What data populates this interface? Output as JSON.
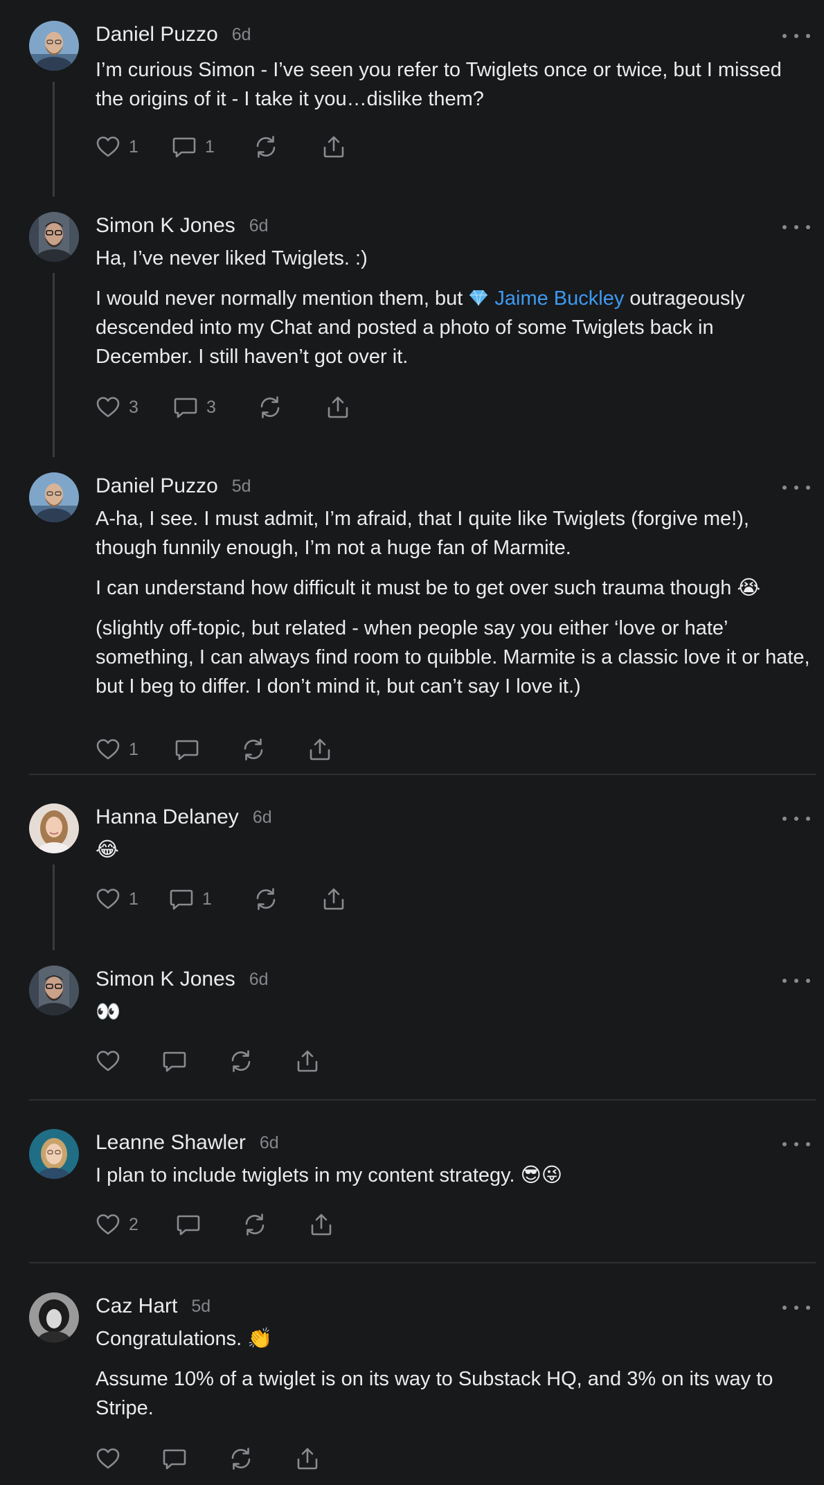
{
  "colors": {
    "background": "#18191b",
    "text": "#ececec",
    "muted": "#86878b",
    "mention": "#3d9af2",
    "thread_line": "#3a3b3e"
  },
  "icons": {
    "like": "heart-icon",
    "comment": "comment-icon",
    "restack": "restack-icon",
    "share": "share-icon",
    "more": "more-icon",
    "mention_badge": "diamond-icon"
  },
  "posts": [
    {
      "author": "Daniel Puzzo",
      "time": "6d",
      "paragraphs": [
        "I’m curious Simon - I’ve seen you refer to Twiglets once or twice, but I missed the origins of it - I take it you…dislike them?"
      ],
      "likes": "1",
      "comments": "1"
    },
    {
      "author": "Simon K Jones",
      "time": "6d",
      "paragraphs": [
        "Ha, I’ve never liked Twiglets. :)"
      ],
      "p2_before": "I would never normally mention them, but ",
      "mention": "Jaime Buckley",
      "p2_after": " outrageously descended into my Chat and posted a photo of some Twiglets back in December. I still haven’t got over it.",
      "likes": "3",
      "comments": "3"
    },
    {
      "author": "Daniel Puzzo",
      "time": "5d",
      "paragraphs": [
        "A-ha, I see. I must admit, I’m afraid, that I quite like Twiglets (forgive me!), though funnily enough, I’m not a huge fan of Marmite.",
        "I can understand how difficult it must be to get over such trauma though 😭",
        "(slightly off-topic, but related - when people say you either ‘love or hate’ something, I can always find room to quibble. Marmite is a classic love it or hate, but I beg to differ. I don’t mind it, but can’t say I love it.)"
      ],
      "likes": "1",
      "comments": ""
    },
    {
      "author": "Hanna Delaney",
      "time": "6d",
      "paragraphs": [
        "😂"
      ],
      "likes": "1",
      "comments": "1"
    },
    {
      "author": "Simon K Jones",
      "time": "6d",
      "paragraphs": [
        "👀"
      ],
      "likes": "",
      "comments": ""
    },
    {
      "author": "Leanne Shawler",
      "time": "6d",
      "paragraphs": [
        "I plan to include twiglets in my content strategy. 😎😜"
      ],
      "likes": "2",
      "comments": ""
    },
    {
      "author": "Caz Hart",
      "time": "5d",
      "paragraphs": [
        "Congratulations. 👏",
        "Assume 10% of a twiglet is on its way to Substack HQ, and 3% on its way to Stripe."
      ],
      "likes": "",
      "comments": ""
    }
  ]
}
